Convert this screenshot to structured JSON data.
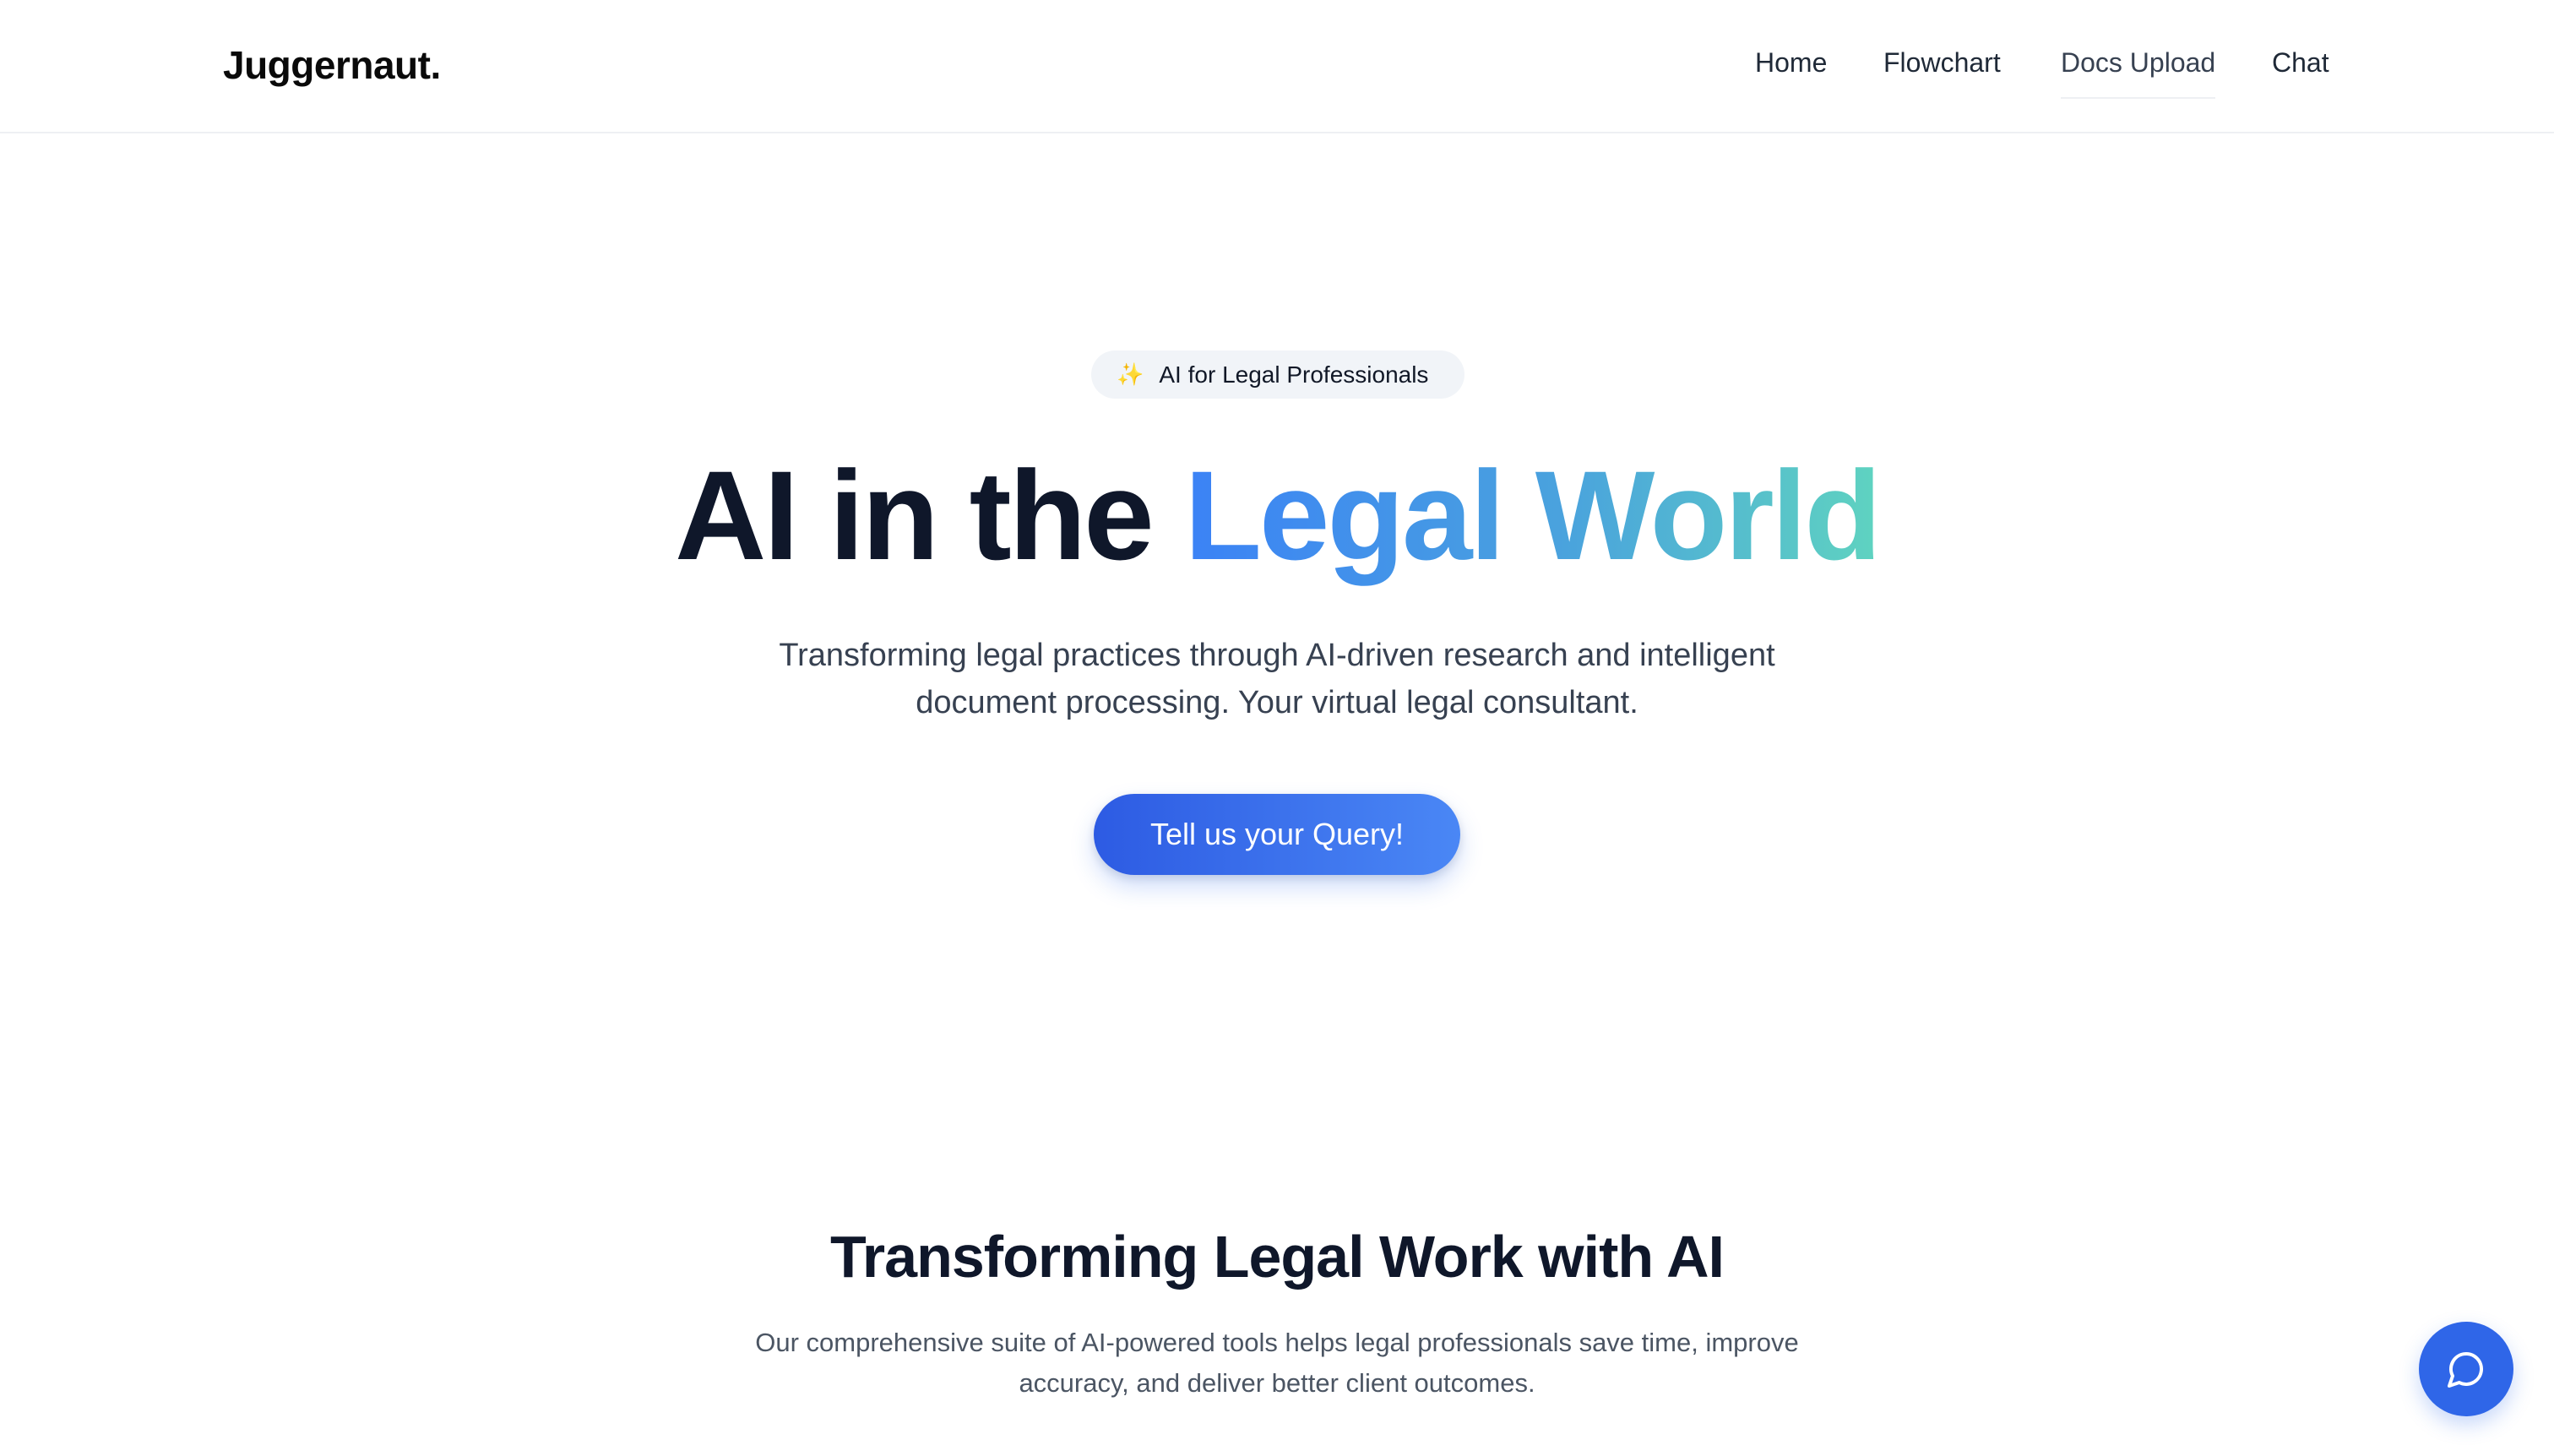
{
  "header": {
    "brand": "Juggernaut.",
    "nav": [
      {
        "label": "Home"
      },
      {
        "label": "Flowchart"
      },
      {
        "label": "Docs Upload"
      },
      {
        "label": "Chat"
      }
    ]
  },
  "hero": {
    "badge": {
      "icon": "sparkles-icon",
      "text": "AI for Legal Professionals"
    },
    "title_plain": "AI in the",
    "title_highlight": "Legal World",
    "subtitle": "Transforming legal practices through AI-driven research and intelligent document processing. Your virtual legal consultant.",
    "cta_label": "Tell us your Query!"
  },
  "features": {
    "title": "Transforming Legal Work with AI",
    "description": "Our comprehensive suite of AI-powered tools helps legal professionals save time, improve accuracy, and deliver better client outcomes."
  },
  "chat_widget": {
    "icon": "chat-bubble-icon"
  },
  "colors": {
    "accent": "#2f66e8",
    "gradient_start": "#3b82f6",
    "gradient_end": "#5fd3c0",
    "heading": "#0f172a"
  }
}
